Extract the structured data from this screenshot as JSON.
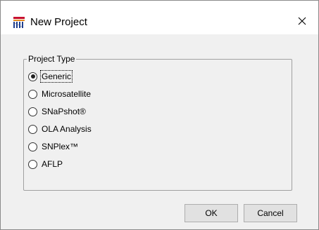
{
  "window": {
    "title": "New Project",
    "app_icon": "grid-app-icon",
    "close_icon": "close-icon"
  },
  "project_type": {
    "legend": "Project Type",
    "options": [
      {
        "label": "Generic",
        "selected": true
      },
      {
        "label": "Microsatellite",
        "selected": false
      },
      {
        "label": "SNaPshot®",
        "selected": false
      },
      {
        "label": "OLA Analysis",
        "selected": false
      },
      {
        "label": "SNPlex™",
        "selected": false
      },
      {
        "label": "AFLP",
        "selected": false
      }
    ]
  },
  "buttons": {
    "ok": "OK",
    "cancel": "Cancel"
  }
}
